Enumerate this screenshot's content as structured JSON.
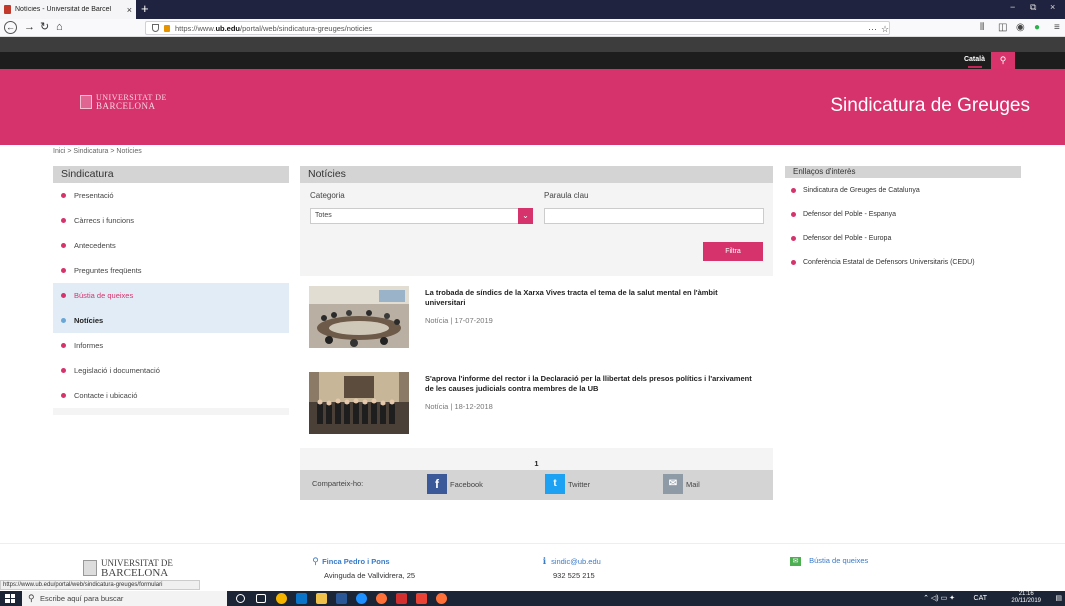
{
  "browser": {
    "tab_title": "Notícies - Universitat de Barcel",
    "tab_close": "×",
    "new_tab": "+",
    "url_prefix": "https://www.",
    "url_domain": "ub.edu",
    "url_path": "/portal/web/sindicatura-greuges/noticies",
    "url_more": "···",
    "win_min": "−",
    "win_max": "⧉",
    "win_close": "×"
  },
  "site": {
    "language": "Català",
    "search_glyph": "⚲",
    "logo_line1": "UNIVERSITAT DE",
    "logo_line2": "BARCELONA",
    "section_title": "Sindicatura de Greuges"
  },
  "breadcrumb": "Inici > Sindicatura > Notícies",
  "sidebar": {
    "title": "Sindicatura",
    "items": [
      {
        "label": "Presentació"
      },
      {
        "label": "Càrrecs i funcions"
      },
      {
        "label": "Antecedents"
      },
      {
        "label": "Preguntes freqüents"
      },
      {
        "label": "Bústia de queixes"
      },
      {
        "label": "Notícies"
      },
      {
        "label": "Informes"
      },
      {
        "label": "Legislació i documentació"
      },
      {
        "label": "Contacte i ubicació"
      }
    ]
  },
  "news": {
    "title": "Notícies",
    "category_label": "Categoria",
    "category_value": "Totes",
    "keyword_label": "Paraula clau",
    "keyword_value": "",
    "filter_button": "Filtra",
    "items": [
      {
        "title": "La trobada de síndics de la Xarxa Vives tracta el tema de la salut mental en l'àmbit universitari",
        "meta": "Notícia | 17-07-2019"
      },
      {
        "title": "S'aprova l'informe del rector i la Declaració per la llibertat dels presos polítics i l'arxivament de les causes judicials contra membres de la UB",
        "meta": "Notícia | 18-12-2018"
      }
    ],
    "page": "1"
  },
  "share": {
    "label": "Comparteix-ho:",
    "facebook": "Facebook",
    "twitter": "Twitter",
    "mail": "Mail"
  },
  "links": {
    "title": "Enllaços d'interès",
    "items": [
      {
        "label": "Sindicatura de Greuges de Catalunya"
      },
      {
        "label": "Defensor del Poble - Espanya"
      },
      {
        "label": "Defensor del Poble - Europa"
      },
      {
        "label": "Conferència Estatal de Defensors Universitaris (CEDU)"
      }
    ]
  },
  "footer": {
    "logo_line1": "UNIVERSITAT DE",
    "logo_line2": "BARCELONA",
    "place_name": "Finca Pedro i Pons",
    "address": "Avinguda de Vallvidrera, 25",
    "email": "sindic@ub.edu",
    "phone": "932 525 215",
    "complaints_link": "Bústia de queixes"
  },
  "status_url": "https://www.ub.edu/portal/web/sindicatura-greuges/formulari",
  "taskbar": {
    "search_placeholder": "Escribe aquí para buscar",
    "language": "CAT",
    "time": "21:16",
    "date": "20/11/2019"
  },
  "colors": {
    "accent": "#d6336d",
    "dark": "#1d1d1d",
    "panel": "#d4d4d4"
  }
}
